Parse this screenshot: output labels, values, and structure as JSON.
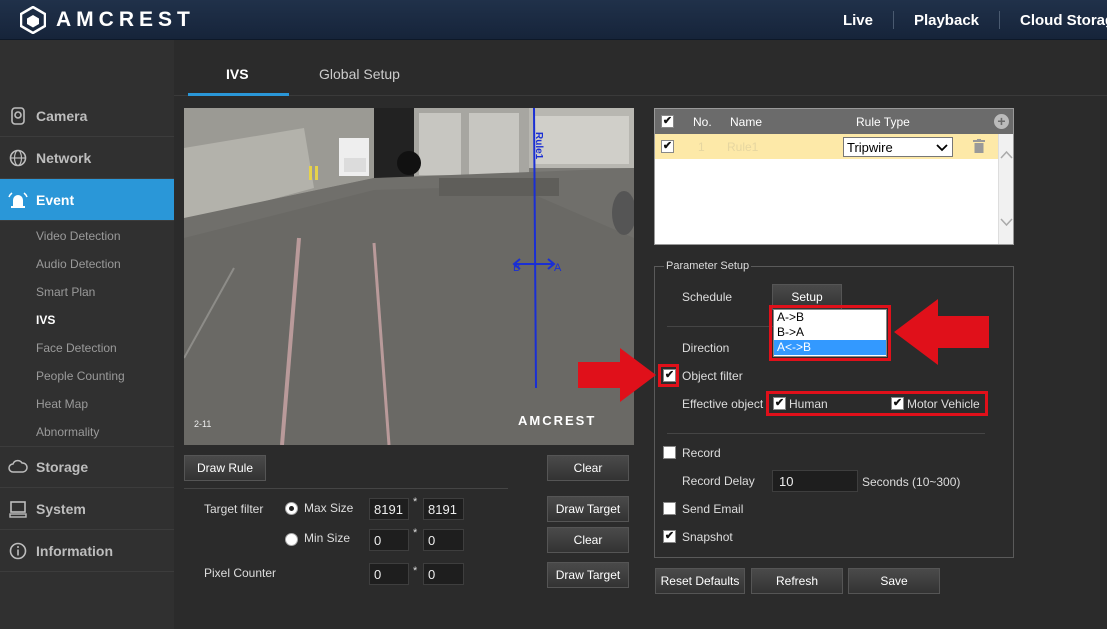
{
  "header": {
    "logo_text": "AMCREST",
    "nav": [
      "Live",
      "Playback",
      "Cloud Storag"
    ]
  },
  "sidebar": {
    "main_items": [
      {
        "label": "Camera",
        "icon": "camera-icon"
      },
      {
        "label": "Network",
        "icon": "globe-icon"
      },
      {
        "label": "Event",
        "icon": "alarm-icon"
      },
      {
        "label": "Storage",
        "icon": "cloud-icon"
      },
      {
        "label": "System",
        "icon": "monitor-icon"
      },
      {
        "label": "Information",
        "icon": "info-icon"
      }
    ],
    "sub_items": [
      "Video Detection",
      "Audio Detection",
      "Smart Plan",
      "IVS",
      "Face Detection",
      "People Counting",
      "Heat Map",
      "Abnormality"
    ],
    "active_main": "Event",
    "active_sub": "IVS"
  },
  "tabs": [
    "IVS",
    "Global Setup"
  ],
  "video": {
    "brand": "AMCREST",
    "stamp": "2-11",
    "rule_label": "Rule1",
    "dir_left": "B",
    "dir_right": "A"
  },
  "left_controls": {
    "draw_rule": "Draw Rule",
    "clear_1": "Clear",
    "target_filter_label": "Target filter",
    "max_size_label": "Max Size",
    "max_w": "8191",
    "max_h": "8191",
    "draw_target_1": "Draw Target",
    "min_size_label": "Min Size",
    "min_w": "0",
    "min_h": "0",
    "clear_2": "Clear",
    "pixel_counter_label": "Pixel Counter",
    "pix_w": "0",
    "pix_h": "0",
    "draw_target_2": "Draw Target",
    "times": "*"
  },
  "rules_table": {
    "headers": [
      "No.",
      "Name",
      "Rule Type"
    ],
    "row": {
      "no": "1",
      "name": "Rule1",
      "type": "Tripwire"
    }
  },
  "params": {
    "title": "Parameter Setup",
    "schedule_label": "Schedule",
    "setup_btn": "Setup",
    "direction_label": "Direction",
    "direction_options": [
      "A->B",
      "B->A",
      "A<->B"
    ],
    "direction_selected": "A<->B",
    "object_filter_label": "Object filter",
    "effective_object_label": "Effective object",
    "human_label": "Human",
    "motor_vehicle_label": "Motor Vehicle",
    "record_label": "Record",
    "record_delay_label": "Record Delay",
    "record_delay_value": "10",
    "record_delay_unit": "Seconds (10~300)",
    "send_email_label": "Send Email",
    "snapshot_label": "Snapshot",
    "check_mark": "✔"
  },
  "footer_buttons": {
    "reset": "Reset Defaults",
    "refresh": "Refresh",
    "save": "Save"
  },
  "colors": {
    "accent": "#2a97d8",
    "annotation_red": "#e0101a",
    "tripwire_blue": "#1a2fd4",
    "selected_row": "#fde9a8"
  }
}
